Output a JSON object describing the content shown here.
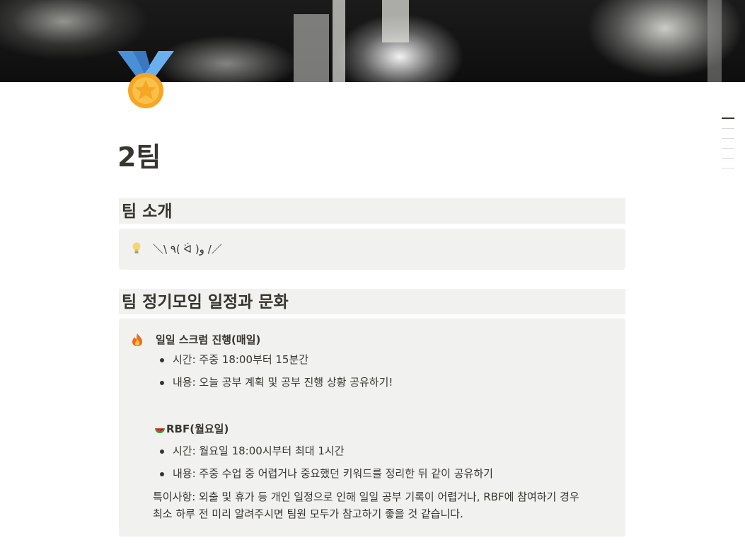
{
  "cover": {
    "alt": "rocket launch cover image"
  },
  "page_icon": "medal-icon",
  "page_title": "2팀",
  "toc": {
    "entries": 6
  },
  "sections": [
    {
      "heading": "팀 소개",
      "callout": {
        "icon": "lightbulb-icon",
        "text": "＼\\ ٩( ᐛ )و /／"
      }
    },
    {
      "heading": "팀 정기모임 일정과 문화",
      "callout": {
        "icon": "fire-icon",
        "scrum_title": "일일 스크럼 진행(매일)",
        "scrum_items": [
          "시간: 주중 18:00부터 15분간",
          "내용: 오늘 공부 계획 및 공부 진행 상황 공유하기!"
        ],
        "rbf_icon": "watermelon-icon",
        "rbf_title": "RBF(월요일)",
        "rbf_items": [
          "시간: 월요일 18:00시부터 최대 1시간",
          "내용: 주중 수업 중 어렵거나 중요했던 키워드를 정리한 뒤 같이 공유하기"
        ],
        "note_line1": "특이사항: 외출 및 휴가 등 개인 일정으로 인해 일일 공부 기록이 어렵거나, RBF에 참여하기 경우",
        "note_line2": "최소 하루 전 미리 알려주시면 팀원 모두가 참고하기 좋을 것 같습니다."
      }
    }
  ]
}
